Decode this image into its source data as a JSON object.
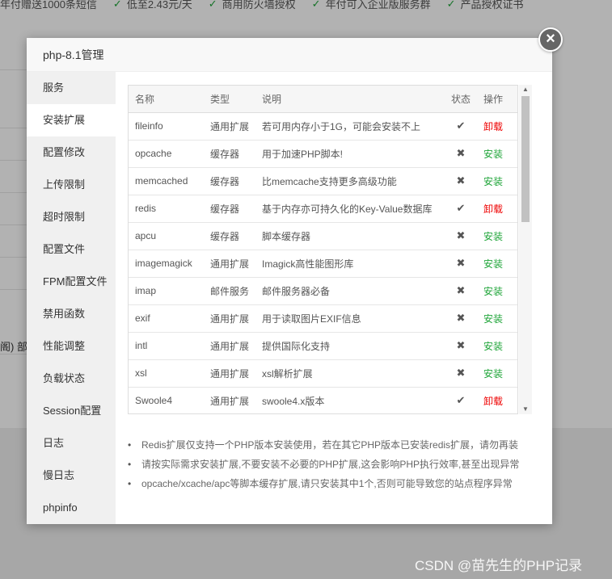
{
  "background": {
    "features": [
      "年付赠送1000条短信",
      "低至2.43元/天",
      "商用防火墙授权",
      "年付可入企业版服务群",
      "产品授权证书"
    ],
    "side_fragment": "阁) 部分"
  },
  "modal": {
    "title": "php-8.1管理",
    "close_icon": "close-icon"
  },
  "sidebar": {
    "items": [
      {
        "label": "服务",
        "active": false
      },
      {
        "label": "安装扩展",
        "active": true
      },
      {
        "label": "配置修改",
        "active": false
      },
      {
        "label": "上传限制",
        "active": false
      },
      {
        "label": "超时限制",
        "active": false
      },
      {
        "label": "配置文件",
        "active": false
      },
      {
        "label": "FPM配置文件",
        "active": false
      },
      {
        "label": "禁用函数",
        "active": false
      },
      {
        "label": "性能调整",
        "active": false
      },
      {
        "label": "负载状态",
        "active": false
      },
      {
        "label": "Session配置",
        "active": false
      },
      {
        "label": "日志",
        "active": false
      },
      {
        "label": "慢日志",
        "active": false
      },
      {
        "label": "phpinfo",
        "active": false
      }
    ]
  },
  "table": {
    "headers": {
      "name": "名称",
      "type": "类型",
      "desc": "说明",
      "status": "状态",
      "op": "操作"
    },
    "rows": [
      {
        "name": "fileinfo",
        "type": "通用扩展",
        "desc": "若可用内存小于1G，可能会安装不上",
        "status": "✔",
        "op": "卸载",
        "installed": true
      },
      {
        "name": "opcache",
        "type": "缓存器",
        "desc": "用于加速PHP脚本!",
        "status": "✖",
        "op": "安装",
        "installed": false
      },
      {
        "name": "memcached",
        "type": "缓存器",
        "desc": "比memcache支持更多高级功能",
        "status": "✖",
        "op": "安装",
        "installed": false
      },
      {
        "name": "redis",
        "type": "缓存器",
        "desc": "基于内存亦可持久化的Key-Value数据库",
        "status": "✔",
        "op": "卸载",
        "installed": true
      },
      {
        "name": "apcu",
        "type": "缓存器",
        "desc": "脚本缓存器",
        "status": "✖",
        "op": "安装",
        "installed": false
      },
      {
        "name": "imagemagick",
        "type": "通用扩展",
        "desc": "Imagick高性能图形库",
        "status": "✖",
        "op": "安装",
        "installed": false
      },
      {
        "name": "imap",
        "type": "邮件服务",
        "desc": "邮件服务器必备",
        "status": "✖",
        "op": "安装",
        "installed": false
      },
      {
        "name": "exif",
        "type": "通用扩展",
        "desc": "用于读取图片EXIF信息",
        "status": "✖",
        "op": "安装",
        "installed": false
      },
      {
        "name": "intl",
        "type": "通用扩展",
        "desc": "提供国际化支持",
        "status": "✖",
        "op": "安装",
        "installed": false
      },
      {
        "name": "xsl",
        "type": "通用扩展",
        "desc": "xsl解析扩展",
        "status": "✖",
        "op": "安装",
        "installed": false
      },
      {
        "name": "Swoole4",
        "type": "通用扩展",
        "desc": "swoole4.x版本",
        "status": "✔",
        "op": "卸载",
        "installed": true
      }
    ]
  },
  "notes": [
    "Redis扩展仅支持一个PHP版本安装使用，若在其它PHP版本已安装redis扩展，请勿再装",
    "请按实际需求安装扩展,不要安装不必要的PHP扩展,这会影响PHP执行效率,甚至出现异常",
    "opcache/xcache/apc等脚本缓存扩展,请只安装其中1个,否则可能导致您的站点程序异常"
  ],
  "watermark": "CSDN @苗先生的PHP记录",
  "colors": {
    "install": "#20a53a",
    "uninstall": "#ee0000",
    "overlay": "rgba(0,0,0,0.3)"
  }
}
